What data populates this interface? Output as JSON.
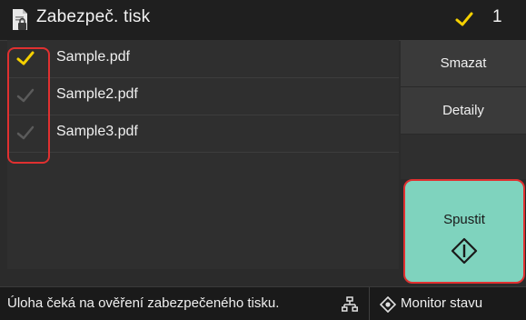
{
  "header": {
    "title": "Zabezpeč. tisk",
    "selected_count": "1",
    "icons": [
      "document-lock-icon",
      "check-icon"
    ]
  },
  "files": [
    {
      "name": "Sample.pdf",
      "checked": true
    },
    {
      "name": "Sample2.pdf",
      "checked": false
    },
    {
      "name": "Sample3.pdf",
      "checked": false
    }
  ],
  "actions": {
    "delete_label": "Smazat",
    "details_label": "Detaily",
    "start_label": "Spustit"
  },
  "status": {
    "message": "Úloha čeká na ověření zabezpečeného tisku.",
    "monitor_label": "Monitor stavu",
    "icons": [
      "network-icon",
      "monitor-status-icon"
    ]
  },
  "colors": {
    "check_active": "#f5d000",
    "check_inactive": "#5b5b5b",
    "start_button": "#7fd3be",
    "highlight": "#e03030"
  }
}
